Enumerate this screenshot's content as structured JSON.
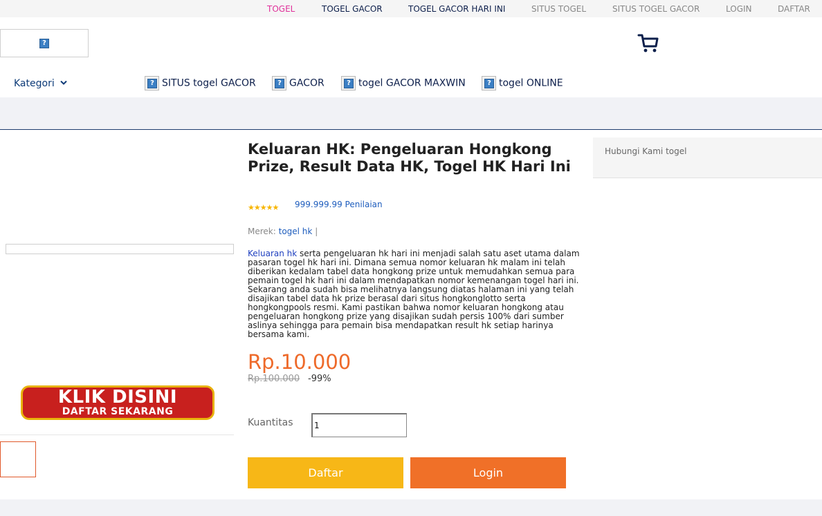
{
  "topbar": {
    "links": [
      "TOGEL",
      "TOGEL GACOR",
      "TOGEL GACOR HARI INI",
      "SITUS TOGEL",
      "SITUS TOGEL GACOR",
      "LOGIN",
      "DAFTAR"
    ],
    "active_color": "#e0309a",
    "dark_color": "#0d1f4b",
    "muted_color": "#8a8a8a"
  },
  "header": {
    "logo_icon": "broken-image-icon",
    "cart_icon": "cart-icon",
    "kategori_label": "Kategori",
    "nav": [
      {
        "label": "SITUS togel GACOR",
        "icon": "broken-image-icon"
      },
      {
        "label": "GACOR",
        "icon": "broken-image-icon"
      },
      {
        "label": "togel GACOR MAXWIN",
        "icon": "broken-image-icon"
      },
      {
        "label": "togel ONLINE",
        "icon": "broken-image-icon"
      }
    ]
  },
  "banner": {
    "line1": "KLIK DISINI",
    "line2": "DAFTAR SEKARANG"
  },
  "product": {
    "title": "Keluaran HK: Pengeluaran Hongkong Prize, Result Data HK, Togel HK Hari Ini",
    "stars": 5,
    "rating_text": "999.999.99 Penilaian",
    "brand_label": "Merek:",
    "brand_value": "togel hk",
    "brand_sep": "|",
    "desc_link": "Keluaran hk",
    "desc_rest": " serta pengeluaran hk hari ini menjadi salah satu aset utama dalam pasaran togel hk hari ini. Dimana semua nomor keluaran hk malam ini telah diberikan kedalam tabel data hongkong prize untuk memudahkan semua para pemain togel hk hari ini dalam mendapatkan nomor kemenangan togel hari ini. Sekarang anda sudah bisa melihatnya langsung diatas halaman ini yang telah disajikan tabel data hk prize berasal dari situs hongkonglotto serta hongkongpools resmi. Kami pastikan bahwa nomor keluaran hongkong atau pengeluaran hongkong prize yang disajikan sudah persis 100% dari sumber aslinya sehingga para pemain bisa mendapatkan result hk setiap harinya bersama kami.",
    "price": "Rp.10.000",
    "old_price": "Rp.100.000",
    "discount": "-99%",
    "qty_label": "Kuantitas",
    "qty_value": "1",
    "btn_daftar": "Daftar",
    "btn_login": "Login",
    "price_color": "#ee6a2a",
    "daftar_color": "#f7b717",
    "login_color": "#f07028"
  },
  "sidebar": {
    "contact": "Hubungi Kami togel"
  }
}
